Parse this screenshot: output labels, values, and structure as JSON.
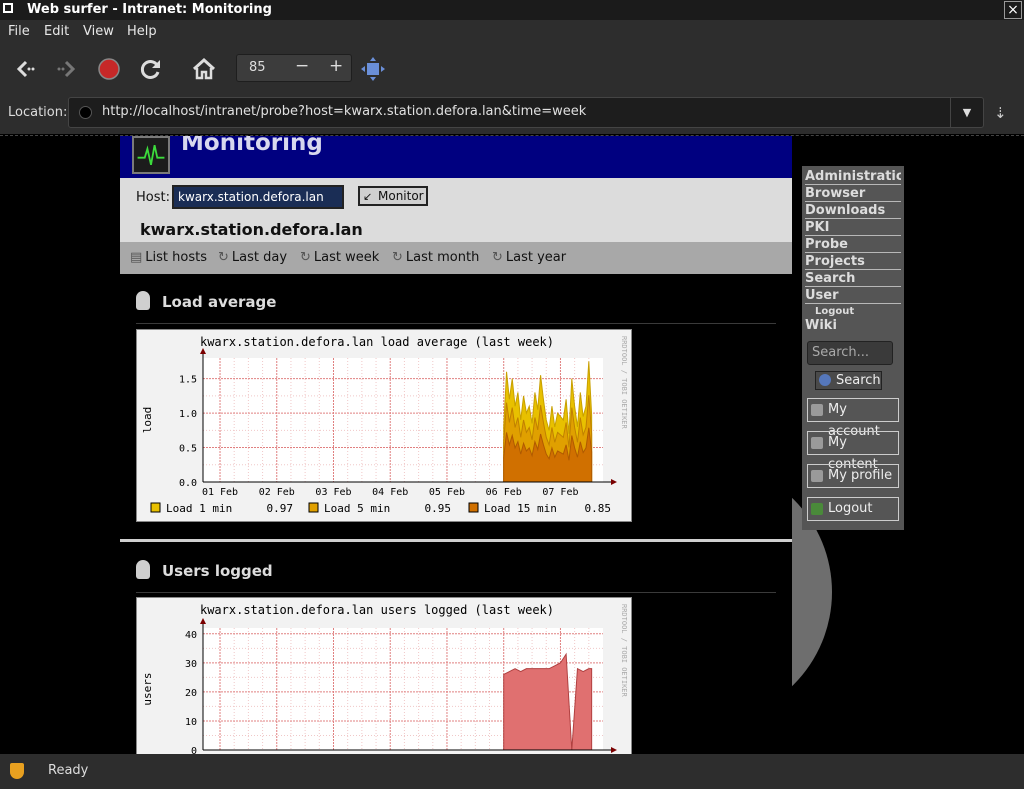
{
  "window": {
    "title": "Web surfer - Intranet: Monitoring",
    "close_icon": "×"
  },
  "menu": {
    "file": "File",
    "edit": "Edit",
    "view": "View",
    "help": "Help"
  },
  "toolbar": {
    "zoom_value": "85",
    "zoom_minus": "−",
    "zoom_plus": "+"
  },
  "location": {
    "label": "Location:",
    "url": "http://localhost/intranet/probe?host=kwarx.station.defora.lan&time=week"
  },
  "page": {
    "title": "Monitoring",
    "host_label": "Host:",
    "host_value": "kwarx.station.defora.lan",
    "monitor_button": "Monitor",
    "host_name": "kwarx.station.defora.lan",
    "nav": [
      "List hosts",
      "Last day",
      "Last week",
      "Last month",
      "Last year"
    ],
    "sections": {
      "load": "Load average",
      "users": "Users logged"
    }
  },
  "chart_data": [
    {
      "type": "area",
      "title": "kwarx.station.defora.lan load average (last week)",
      "ylabel": "load",
      "watermark": "RRDTOOL / TOBI OETIKER",
      "categories": [
        "01 Feb",
        "02 Feb",
        "03 Feb",
        "04 Feb",
        "05 Feb",
        "06 Feb",
        "07 Feb"
      ],
      "yticks": [
        "0.0",
        "0.5",
        "1.0",
        "1.5"
      ],
      "ylim": [
        0,
        1.8
      ],
      "series": [
        {
          "name": "Load 1 min",
          "current": "0.97",
          "color": "#e8c000"
        },
        {
          "name": "Load 5 min",
          "current": "0.95",
          "color": "#e0a000"
        },
        {
          "name": "Load 15 min",
          "current": "0.85",
          "color": "#d07000"
        }
      ],
      "x": [
        6.0,
        6.05,
        6.1,
        6.15,
        6.2,
        6.25,
        6.3,
        6.35,
        6.4,
        6.45,
        6.5,
        6.55,
        6.6,
        6.65,
        6.7,
        6.75,
        6.8,
        6.85,
        6.9,
        6.95,
        7.0,
        7.05,
        7.1,
        7.15,
        7.2,
        7.25,
        7.3,
        7.35,
        7.4,
        7.45,
        7.5,
        7.55
      ],
      "values": [
        0.8,
        1.6,
        1.2,
        1.5,
        1.1,
        1.3,
        0.9,
        1.25,
        1.0,
        1.1,
        0.85,
        1.3,
        1.05,
        1.55,
        1.2,
        0.9,
        0.75,
        1.1,
        0.8,
        1.0,
        0.95,
        0.9,
        1.2,
        0.7,
        1.5,
        1.1,
        0.8,
        1.3,
        0.95,
        1.1,
        1.75,
        0.97
      ]
    },
    {
      "type": "area",
      "title": "kwarx.station.defora.lan users logged (last week)",
      "ylabel": "users",
      "watermark": "RRDTOOL / TOBI OETIKER",
      "yticks": [
        "0",
        "10",
        "20",
        "30",
        "40"
      ],
      "ylim": [
        0,
        42
      ],
      "series": [
        {
          "name": "users",
          "color": "#e07070"
        }
      ],
      "x": [
        6.0,
        6.1,
        6.2,
        6.3,
        6.4,
        6.5,
        6.6,
        6.7,
        6.8,
        6.9,
        7.0,
        7.1,
        7.2,
        7.3,
        7.4,
        7.5,
        7.55
      ],
      "values": [
        26,
        27,
        28,
        27,
        28,
        28,
        28,
        28,
        28,
        29,
        30,
        33,
        0,
        28,
        27,
        28,
        28
      ]
    }
  ],
  "sidebar": {
    "items": [
      "Administration",
      "Browser",
      "Downloads",
      "PKI",
      "Probe",
      "Projects",
      "Search",
      "User"
    ],
    "logout_sub": "Logout",
    "wiki": "Wiki",
    "search_placeholder": "Search...",
    "search_button": "Search",
    "my_account": "My account",
    "my_content": "My content",
    "my_profile": "My profile",
    "logout": "Logout"
  },
  "status": {
    "text": "Ready"
  }
}
